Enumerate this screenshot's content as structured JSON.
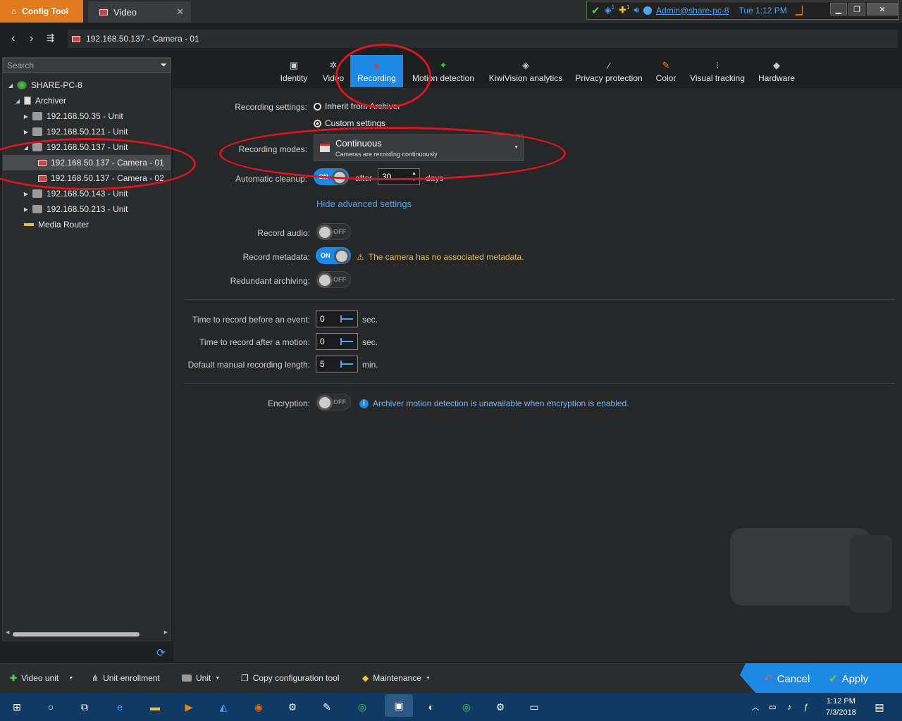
{
  "titlebar": {
    "app_tab": "Config Tool",
    "doc_tab": "Video",
    "user": "Admin@share-pc-8",
    "clock": "Tue 1:12 PM",
    "badge1": "1",
    "badge2": "1"
  },
  "address": {
    "path": "192.168.50.137 - Camera - 01"
  },
  "search": {
    "placeholder": "Search"
  },
  "tree": [
    {
      "label": "SHARE-PC-8",
      "level": 0,
      "icon": "globe-icon"
    },
    {
      "label": "Archiver",
      "level": 1,
      "icon": "server-icon"
    },
    {
      "label": "192.168.50.35 - Unit",
      "level": 2,
      "icon": "unit-icon"
    },
    {
      "label": "192.168.50.121 - Unit",
      "level": 2,
      "icon": "unit-icon"
    },
    {
      "label": "192.168.50.137 - Unit",
      "level": 2,
      "icon": "unit-icon"
    },
    {
      "label": "192.168.50.137 - Camera - 01",
      "level": 3,
      "icon": "camera-icon"
    },
    {
      "label": "192.168.50.137 - Camera - 02",
      "level": 3,
      "icon": "camera-icon"
    },
    {
      "label": "192.168.50.143 - Unit",
      "level": 2,
      "icon": "unit-icon"
    },
    {
      "label": "192.168.50.213 - Unit",
      "level": 2,
      "icon": "unit-icon"
    },
    {
      "label": "Media Router",
      "level": 1,
      "icon": "router-icon"
    }
  ],
  "tabs": [
    {
      "label": "Identity"
    },
    {
      "label": "Video"
    },
    {
      "label": "Recording"
    },
    {
      "label": "Motion detection"
    },
    {
      "label": "KiwiVision analytics"
    },
    {
      "label": "Privacy protection"
    },
    {
      "label": "Color"
    },
    {
      "label": "Visual tracking"
    },
    {
      "label": "Hardware"
    }
  ],
  "recording": {
    "settings_label": "Recording settings:",
    "inherit": "Inherit from Archiver",
    "custom": "Custom settings",
    "modes_label": "Recording modes:",
    "mode_value": "Continuous",
    "mode_desc": "Cameras are recording continuously",
    "cleanup_label": "Automatic cleanup:",
    "cleanup_state": "ON",
    "after": "after",
    "days_value": "30",
    "days": "days",
    "advanced_link": "Hide advanced settings",
    "audio_label": "Record audio:",
    "audio_state": "OFF",
    "metadata_label": "Record metadata:",
    "metadata_state": "ON",
    "metadata_warning": "The camera has no associated metadata.",
    "redundant_label": "Redundant archiving:",
    "redundant_state": "OFF",
    "before_label": "Time to record before an event:",
    "before_value": "0",
    "before_unit": "sec.",
    "after_label": "Time to record after a motion:",
    "after_value": "0",
    "after_unit": "sec.",
    "manual_label": "Default manual recording length:",
    "manual_value": "5",
    "manual_unit": "min.",
    "encryption_label": "Encryption:",
    "encryption_state": "OFF",
    "encryption_info": "Archiver motion detection is unavailable when encryption is enabled."
  },
  "toolbar": {
    "video_unit": "Video unit",
    "enrollment": "Unit enrollment",
    "unit": "Unit",
    "copy": "Copy configuration tool",
    "maintenance": "Maintenance",
    "cancel": "Cancel",
    "apply": "Apply"
  },
  "taskbar": {
    "time": "1:12 PM",
    "date": "7/3/2018"
  },
  "colors": {
    "accent": "#1e88e5",
    "orange_tab": "#e07b1f",
    "annotation_red": "#e0141e",
    "warning": "#e8c33a"
  }
}
